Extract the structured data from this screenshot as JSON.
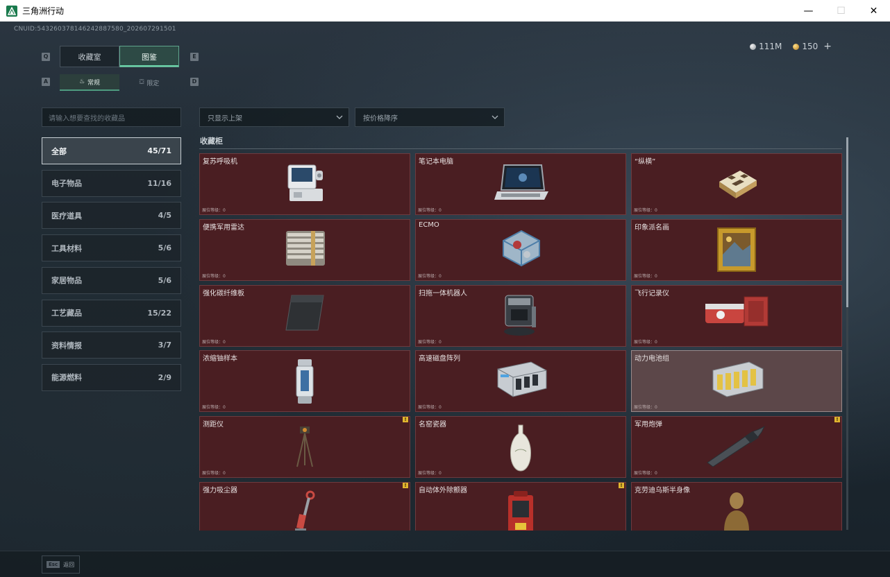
{
  "window": {
    "title": "三角洲行动",
    "minimize": "—",
    "maximize": "☐",
    "close": "✕"
  },
  "uid": "CNUID:543260378146242887580_202607291501",
  "currency": {
    "silver": "111M",
    "gold": "150",
    "plus": "+"
  },
  "main_tabs": [
    {
      "label": "收藏室",
      "active": false
    },
    {
      "label": "图鉴",
      "active": true
    }
  ],
  "sub_tabs": [
    {
      "label": "常规",
      "active": true
    },
    {
      "label": "限定",
      "active": false
    }
  ],
  "key_hints": {
    "q": "Q",
    "e": "E",
    "a": "A",
    "d": "D"
  },
  "search": {
    "placeholder": "请输入想要查找的收藏品"
  },
  "filter": {
    "shelf": "只显示上架",
    "sort": "按价格降序"
  },
  "categories": [
    {
      "label": "全部",
      "count": "45/71",
      "active": true
    },
    {
      "label": "电子物品",
      "count": "11/16",
      "active": false
    },
    {
      "label": "医疗道具",
      "count": "4/5",
      "active": false
    },
    {
      "label": "工具材料",
      "count": "5/6",
      "active": false
    },
    {
      "label": "家居物品",
      "count": "5/6",
      "active": false
    },
    {
      "label": "工艺藏品",
      "count": "15/22",
      "active": false
    },
    {
      "label": "资料情报",
      "count": "3/7",
      "active": false
    },
    {
      "label": "能源燃料",
      "count": "2/9",
      "active": false
    }
  ],
  "section_title": "收藏柜",
  "level_label": "展位等级：0",
  "items": [
    {
      "name": "复苏呼吸机",
      "icon": "ventilator-icon",
      "badge": false,
      "hover": false
    },
    {
      "name": "笔记本电脑",
      "icon": "laptop-icon",
      "badge": false,
      "hover": false
    },
    {
      "name": "“纵横”",
      "icon": "chessboard-icon",
      "badge": false,
      "hover": false
    },
    {
      "name": "便携军用雷达",
      "icon": "radar-icon",
      "badge": false,
      "hover": false
    },
    {
      "name": "ECMO",
      "icon": "ecmo-icon",
      "badge": false,
      "hover": false
    },
    {
      "name": "印象派名画",
      "icon": "painting-icon",
      "badge": false,
      "hover": false
    },
    {
      "name": "强化碳纤维板",
      "icon": "carbon-plate-icon",
      "badge": false,
      "hover": false
    },
    {
      "name": "扫拖一体机器人",
      "icon": "robot-vacuum-icon",
      "badge": false,
      "hover": false
    },
    {
      "name": "飞行记录仪",
      "icon": "flight-recorder-icon",
      "badge": false,
      "hover": false
    },
    {
      "name": "浓缩铀样本",
      "icon": "uranium-sample-icon",
      "badge": false,
      "hover": false
    },
    {
      "name": "高速磁盘阵列",
      "icon": "disk-array-icon",
      "badge": false,
      "hover": false
    },
    {
      "name": "动力电池组",
      "icon": "battery-pack-icon",
      "badge": false,
      "hover": true
    },
    {
      "name": "测距仪",
      "icon": "rangefinder-icon",
      "badge": true,
      "hover": false
    },
    {
      "name": "名窑瓷器",
      "icon": "porcelain-vase-icon",
      "badge": false,
      "hover": false
    },
    {
      "name": "军用炮弹",
      "icon": "artillery-shell-icon",
      "badge": true,
      "hover": false
    },
    {
      "name": "强力吸尘器",
      "icon": "vacuum-cleaner-icon",
      "badge": true,
      "hover": false
    },
    {
      "name": "自动体外除颤器",
      "icon": "defibrillator-icon",
      "badge": true,
      "hover": false
    },
    {
      "name": "克劳迪乌斯半身像",
      "icon": "bust-statue-icon",
      "badge": false,
      "hover": false
    }
  ],
  "badge_text": "!",
  "bottom": {
    "esc": "Esc",
    "back": "返回"
  }
}
